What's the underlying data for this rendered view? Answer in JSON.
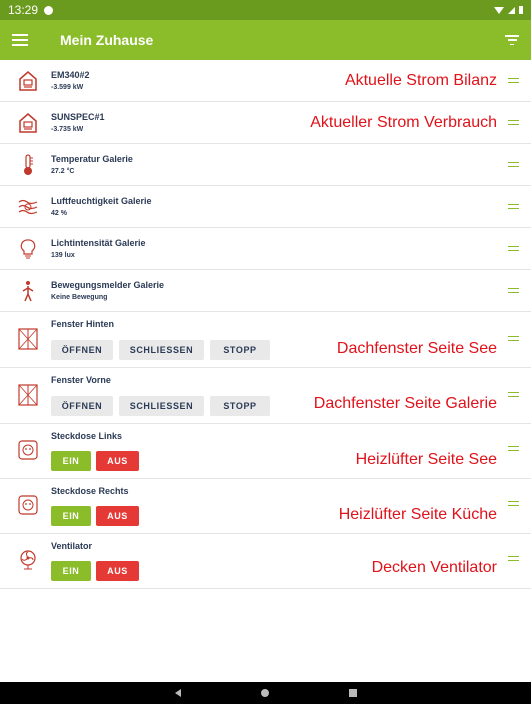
{
  "status": {
    "time": "13:29"
  },
  "header": {
    "title": "Mein Zuhause"
  },
  "devices": [
    {
      "name": "EM340#2",
      "value": "-3.599 kW",
      "annotation": "Aktuelle Strom Bilanz"
    },
    {
      "name": "SUNSPEC#1",
      "value": "-3.735 kW",
      "annotation": "Aktueller Strom Verbrauch"
    },
    {
      "name": "Temperatur Galerie",
      "value": "27.2 °C"
    },
    {
      "name": "Luftfeuchtigkeit Galerie",
      "value": "42 %"
    },
    {
      "name": "Lichtintensität Galerie",
      "value": "139 lux"
    },
    {
      "name": "Bewegungsmelder Galerie",
      "value": "Keine Bewegung"
    },
    {
      "name": "Fenster Hinten",
      "annotation": "Dachfenster Seite See",
      "buttons": [
        "ÖFFNEN",
        "SCHLIESSEN",
        "STOPP"
      ]
    },
    {
      "name": "Fenster Vorne",
      "annotation": "Dachfenster Seite Galerie",
      "buttons": [
        "ÖFFNEN",
        "SCHLIESSEN",
        "STOPP"
      ]
    },
    {
      "name": "Steckdose Links",
      "annotation": "Heizlüfter Seite See",
      "buttons": [
        "EIN",
        "AUS"
      ]
    },
    {
      "name": "Steckdose Rechts",
      "annotation": "Heizlüfter Seite Küche",
      "buttons": [
        "EIN",
        "AUS"
      ]
    },
    {
      "name": "Ventilator",
      "annotation": "Decken Ventilator",
      "buttons": [
        "EIN",
        "AUS"
      ]
    }
  ]
}
